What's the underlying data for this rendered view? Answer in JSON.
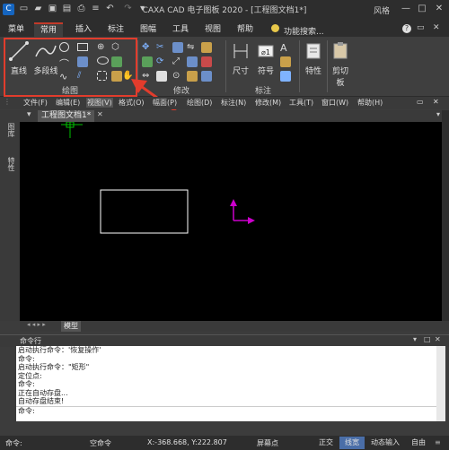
{
  "title": "CAXA CAD 电子图板 2020 - [工程图文档1*]",
  "window_user": "风格",
  "ribbon_tabs": [
    "菜单",
    "常用",
    "插入",
    "标注",
    "图幅",
    "工具",
    "视图",
    "帮助"
  ],
  "active_tab": "常用",
  "search_label": "功能搜索...",
  "ribbon": {
    "draw": {
      "line": "直线",
      "polyline": "多段线",
      "group": "绘图"
    },
    "modify": {
      "group": "修改"
    },
    "annotate": {
      "dimension": "尺寸",
      "symbol": "符号",
      "group": "标注"
    },
    "properties": {
      "label": "特性"
    },
    "clipboard": {
      "label": "剪切板"
    }
  },
  "menubar": [
    "文件(F)",
    "编辑(E)",
    "视图(V)",
    "格式(O)",
    "幅面(P)",
    "绘图(D)",
    "标注(N)",
    "修改(M)",
    "工具(T)",
    "窗口(W)",
    "帮助(H)"
  ],
  "doc_tab": "工程图文档1*",
  "side_tabs": [
    "图库",
    "特性"
  ],
  "model_tab": "模型",
  "command_panel": {
    "title": "命令行",
    "lines": [
      "启动执行命令：'恢复操作'",
      "命令:",
      "启动执行命令：\"矩形\"",
      "定位点:",
      "命令:",
      "正在自动存盘...",
      "自动存盘结束!",
      "命令:"
    ]
  },
  "status": {
    "left": "命令:",
    "mode": "空命令",
    "coords": "X:-368.668, Y:222.807",
    "snap": "屏幕点",
    "buttons": [
      "正交",
      "线宽",
      "动态输入",
      "自由"
    ]
  },
  "colors": {
    "highlight": "#e23c2c",
    "ucs": "#cc00cc",
    "cursor": "#00c000",
    "tab_accent": "#c23a2a"
  }
}
